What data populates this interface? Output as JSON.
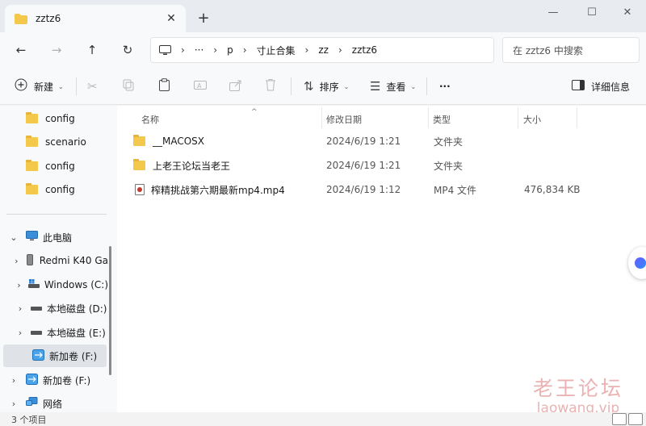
{
  "window": {
    "tab_title": "zztz6",
    "new_tab_symbol": "+",
    "close_symbol": "✕",
    "controls": {
      "minimize": "—",
      "maximize": "☐",
      "close": "✕"
    }
  },
  "navigation": {
    "back": "←",
    "forward": "→",
    "up": "↑",
    "refresh": "↻",
    "breadcrumbs": [
      "···",
      "p",
      "寸止合集",
      "zz",
      "zztz6"
    ],
    "separator": "›",
    "search_placeholder": "在 zztz6 中搜索"
  },
  "toolbar": {
    "new_label": "新建",
    "sort_label": "排序",
    "view_label": "查看",
    "more_label": "···",
    "details_label": "详细信息"
  },
  "sidebar": {
    "quick_folders": [
      {
        "label": "config"
      },
      {
        "label": "scenario"
      },
      {
        "label": "config"
      },
      {
        "label": "config"
      }
    ],
    "this_pc": "此电脑",
    "drives": [
      {
        "label": "Redmi K40 Ga"
      },
      {
        "label": "Windows (C:)"
      },
      {
        "label": "本地磁盘 (D:)"
      },
      {
        "label": "本地磁盘 (E:)"
      },
      {
        "label": "新加卷 (F:)"
      }
    ],
    "extra_drive": "新加卷 (F:)",
    "network": "网络"
  },
  "columns": {
    "name": "名称",
    "modified": "修改日期",
    "type": "类型",
    "size": "大小"
  },
  "files": [
    {
      "name": "__MACOSX",
      "modified": "2024/6/19 1:21",
      "type": "文件夹",
      "size": ""
    },
    {
      "name": "上老王论坛当老王",
      "modified": "2024/6/19 1:21",
      "type": "文件夹",
      "size": ""
    },
    {
      "name": "榨精挑战第六期最新mp4.mp4",
      "modified": "2024/6/19 1:12",
      "type": "MP4 文件",
      "size": "476,834 KB"
    }
  ],
  "status": {
    "item_count": "3 个项目"
  },
  "watermark": {
    "title": "老王论坛",
    "url": "laowang.vip"
  },
  "colors": {
    "folder": "#f4c84a",
    "watermark": "#e6a0a0",
    "selected": "#dfe3e8"
  }
}
